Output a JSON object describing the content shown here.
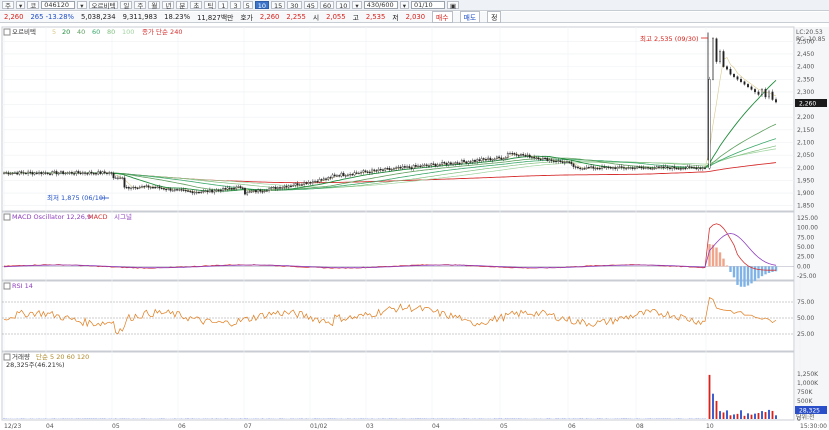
{
  "toolbar": {
    "items": [
      "주",
      "▾",
      "코",
      "046120",
      "▾",
      "오르비텍",
      "일",
      "주",
      "월",
      "년",
      "분",
      "초",
      "틱",
      "1",
      "3",
      "5",
      "10",
      "15",
      "30",
      "45",
      "60",
      "10",
      "▾",
      "430/600",
      "▾",
      "01/10",
      "▣"
    ],
    "active_index": 16
  },
  "quote": {
    "price": "2,260",
    "change": "265 -13.28%",
    "volume": "5,038,234",
    "amount": "9,311,983",
    "rate": "18.23%",
    "mcap": "11,827백만",
    "hoga_label": "호가",
    "ask": "2,260",
    "bid": "2,255",
    "open_label": "시",
    "open": "2,055",
    "high_label": "고",
    "high": "2,535",
    "low_label": "저",
    "low": "2,030",
    "buy_btn": "매수",
    "sell_btn": "매도",
    "extra_btn": "정"
  },
  "colors": {
    "up": "#d8221b",
    "down": "#1f4fc7",
    "ma5": "#d8c98a",
    "ma20": "#1e8c3a",
    "ma40": "#5c9e5c",
    "ma60": "#3aa86a",
    "ma80": "#80c080",
    "ma100": "#9fd39f",
    "ma240": "#d63030",
    "macd": "#d63030",
    "signal": "#8f3fbf",
    "rsi": "#e07b1a",
    "volume_bar": "#2a4fc9"
  },
  "price_panel": {
    "legend_name": "오르비텍",
    "legend_ma": [
      "5",
      "20",
      "40",
      "60",
      "80",
      "100"
    ],
    "legend_extra": "종가 단순 240",
    "high_note": "최고 2,535 (09/30)",
    "low_note": "최저 1,875 (06/10)",
    "right_top_1": "LC:20.53",
    "right_top_2": "RC:-10.85",
    "current_tag": "2,260",
    "y_ticks": [
      "2,500",
      "2,450",
      "2,400",
      "2,350",
      "2,300",
      "2,250",
      "2,200",
      "2,150",
      "2,100",
      "2,050",
      "2,000",
      "1,950",
      "1,900",
      "1,850"
    ]
  },
  "macd_panel": {
    "legend": "MACD Oscillator 12,26,9",
    "legend2": "MACD",
    "legend3": "시그널",
    "y_ticks": [
      "125.00",
      "100.00",
      "75.00",
      "50.00",
      "25.00",
      "0.00",
      "-25.00"
    ]
  },
  "rsi_panel": {
    "legend": "RSI 14",
    "y_ticks": [
      "75.00",
      "50.00",
      "25.00"
    ]
  },
  "volume_panel": {
    "legend": "거래량",
    "legend_ma": "단순 5 20 60 120",
    "legend_value": "28,325주(46.21%)",
    "y_ticks": [
      "1,250K",
      "1,000K",
      "750K",
      "500K",
      "250K",
      "0"
    ],
    "current_tag": "28,325",
    "right_unit": "단위:천"
  },
  "x_axis": {
    "labels": [
      "12/23",
      "04",
      "05",
      "06",
      "07",
      "08",
      "09",
      "01/02",
      "03",
      "04",
      "05",
      "06",
      "07",
      "08",
      "09",
      "10",
      "15:30:00"
    ]
  }
}
